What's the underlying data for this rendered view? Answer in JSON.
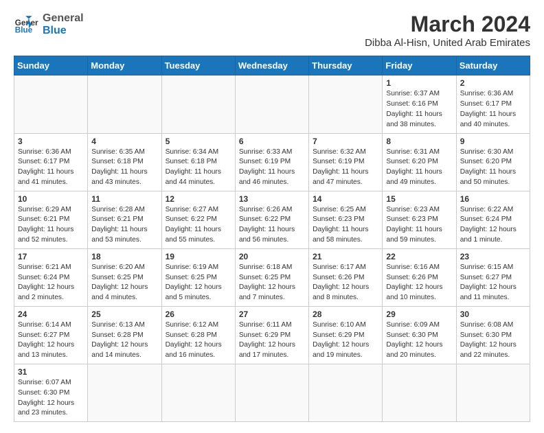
{
  "header": {
    "logo_general": "General",
    "logo_blue": "Blue",
    "month_year": "March 2024",
    "location": "Dibba Al-Hisn, United Arab Emirates"
  },
  "weekdays": [
    "Sunday",
    "Monday",
    "Tuesday",
    "Wednesday",
    "Thursday",
    "Friday",
    "Saturday"
  ],
  "weeks": [
    [
      {
        "day": "",
        "info": ""
      },
      {
        "day": "",
        "info": ""
      },
      {
        "day": "",
        "info": ""
      },
      {
        "day": "",
        "info": ""
      },
      {
        "day": "",
        "info": ""
      },
      {
        "day": "1",
        "info": "Sunrise: 6:37 AM\nSunset: 6:16 PM\nDaylight: 11 hours\nand 38 minutes."
      },
      {
        "day": "2",
        "info": "Sunrise: 6:36 AM\nSunset: 6:17 PM\nDaylight: 11 hours\nand 40 minutes."
      }
    ],
    [
      {
        "day": "3",
        "info": "Sunrise: 6:36 AM\nSunset: 6:17 PM\nDaylight: 11 hours\nand 41 minutes."
      },
      {
        "day": "4",
        "info": "Sunrise: 6:35 AM\nSunset: 6:18 PM\nDaylight: 11 hours\nand 43 minutes."
      },
      {
        "day": "5",
        "info": "Sunrise: 6:34 AM\nSunset: 6:18 PM\nDaylight: 11 hours\nand 44 minutes."
      },
      {
        "day": "6",
        "info": "Sunrise: 6:33 AM\nSunset: 6:19 PM\nDaylight: 11 hours\nand 46 minutes."
      },
      {
        "day": "7",
        "info": "Sunrise: 6:32 AM\nSunset: 6:19 PM\nDaylight: 11 hours\nand 47 minutes."
      },
      {
        "day": "8",
        "info": "Sunrise: 6:31 AM\nSunset: 6:20 PM\nDaylight: 11 hours\nand 49 minutes."
      },
      {
        "day": "9",
        "info": "Sunrise: 6:30 AM\nSunset: 6:20 PM\nDaylight: 11 hours\nand 50 minutes."
      }
    ],
    [
      {
        "day": "10",
        "info": "Sunrise: 6:29 AM\nSunset: 6:21 PM\nDaylight: 11 hours\nand 52 minutes."
      },
      {
        "day": "11",
        "info": "Sunrise: 6:28 AM\nSunset: 6:21 PM\nDaylight: 11 hours\nand 53 minutes."
      },
      {
        "day": "12",
        "info": "Sunrise: 6:27 AM\nSunset: 6:22 PM\nDaylight: 11 hours\nand 55 minutes."
      },
      {
        "day": "13",
        "info": "Sunrise: 6:26 AM\nSunset: 6:22 PM\nDaylight: 11 hours\nand 56 minutes."
      },
      {
        "day": "14",
        "info": "Sunrise: 6:25 AM\nSunset: 6:23 PM\nDaylight: 11 hours\nand 58 minutes."
      },
      {
        "day": "15",
        "info": "Sunrise: 6:23 AM\nSunset: 6:23 PM\nDaylight: 11 hours\nand 59 minutes."
      },
      {
        "day": "16",
        "info": "Sunrise: 6:22 AM\nSunset: 6:24 PM\nDaylight: 12 hours\nand 1 minute."
      }
    ],
    [
      {
        "day": "17",
        "info": "Sunrise: 6:21 AM\nSunset: 6:24 PM\nDaylight: 12 hours\nand 2 minutes."
      },
      {
        "day": "18",
        "info": "Sunrise: 6:20 AM\nSunset: 6:25 PM\nDaylight: 12 hours\nand 4 minutes."
      },
      {
        "day": "19",
        "info": "Sunrise: 6:19 AM\nSunset: 6:25 PM\nDaylight: 12 hours\nand 5 minutes."
      },
      {
        "day": "20",
        "info": "Sunrise: 6:18 AM\nSunset: 6:25 PM\nDaylight: 12 hours\nand 7 minutes."
      },
      {
        "day": "21",
        "info": "Sunrise: 6:17 AM\nSunset: 6:26 PM\nDaylight: 12 hours\nand 8 minutes."
      },
      {
        "day": "22",
        "info": "Sunrise: 6:16 AM\nSunset: 6:26 PM\nDaylight: 12 hours\nand 10 minutes."
      },
      {
        "day": "23",
        "info": "Sunrise: 6:15 AM\nSunset: 6:27 PM\nDaylight: 12 hours\nand 11 minutes."
      }
    ],
    [
      {
        "day": "24",
        "info": "Sunrise: 6:14 AM\nSunset: 6:27 PM\nDaylight: 12 hours\nand 13 minutes."
      },
      {
        "day": "25",
        "info": "Sunrise: 6:13 AM\nSunset: 6:28 PM\nDaylight: 12 hours\nand 14 minutes."
      },
      {
        "day": "26",
        "info": "Sunrise: 6:12 AM\nSunset: 6:28 PM\nDaylight: 12 hours\nand 16 minutes."
      },
      {
        "day": "27",
        "info": "Sunrise: 6:11 AM\nSunset: 6:29 PM\nDaylight: 12 hours\nand 17 minutes."
      },
      {
        "day": "28",
        "info": "Sunrise: 6:10 AM\nSunset: 6:29 PM\nDaylight: 12 hours\nand 19 minutes."
      },
      {
        "day": "29",
        "info": "Sunrise: 6:09 AM\nSunset: 6:30 PM\nDaylight: 12 hours\nand 20 minutes."
      },
      {
        "day": "30",
        "info": "Sunrise: 6:08 AM\nSunset: 6:30 PM\nDaylight: 12 hours\nand 22 minutes."
      }
    ],
    [
      {
        "day": "31",
        "info": "Sunrise: 6:07 AM\nSunset: 6:30 PM\nDaylight: 12 hours\nand 23 minutes."
      },
      {
        "day": "",
        "info": ""
      },
      {
        "day": "",
        "info": ""
      },
      {
        "day": "",
        "info": ""
      },
      {
        "day": "",
        "info": ""
      },
      {
        "day": "",
        "info": ""
      },
      {
        "day": "",
        "info": ""
      }
    ]
  ]
}
